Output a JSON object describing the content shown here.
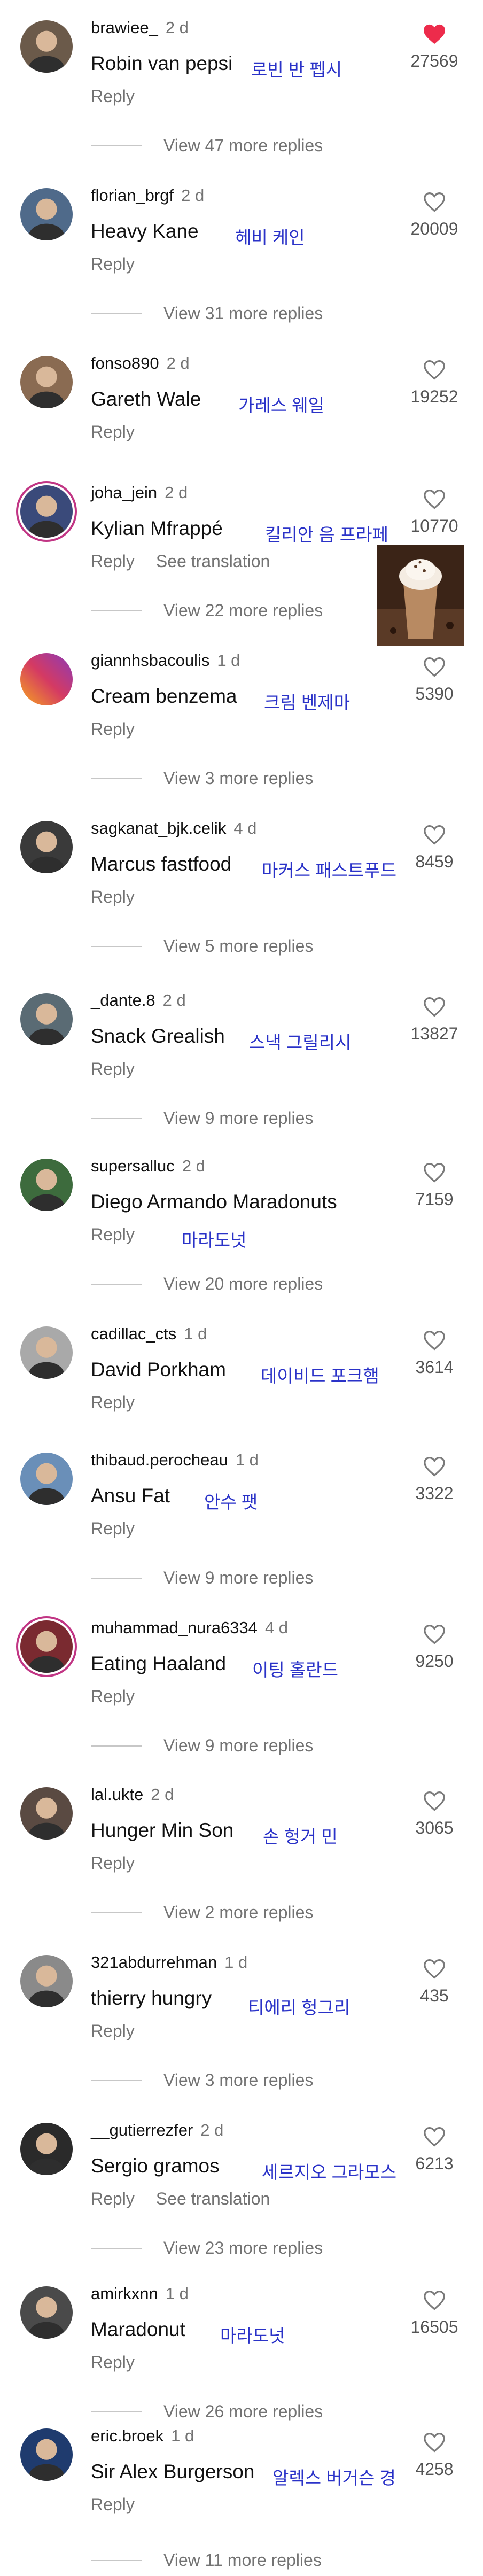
{
  "comments": [
    {
      "username": "brawiee_",
      "age": "2 d",
      "text": "Robin van pepsi",
      "korean": "로빈 반 펩시",
      "reply": "Reply",
      "likes": "27569",
      "liked": true,
      "view_more": "View 47 more replies",
      "avatar_color": "#6b5a4a"
    },
    {
      "username": "florian_brgf",
      "age": "2 d",
      "text": "Heavy Kane",
      "korean": "헤비 케인",
      "reply": "Reply",
      "likes": "20009",
      "liked": false,
      "view_more": "View 31 more replies",
      "avatar_color": "#4f6a8a"
    },
    {
      "username": "fonso890",
      "age": "2 d",
      "text": "Gareth Wale",
      "korean": "가레스 웨일",
      "reply": "Reply",
      "likes": "19252",
      "liked": false,
      "view_more": "View 22 more replies",
      "avatar_color": "#8a6b52"
    },
    {
      "username": "joha_jein",
      "age": "2 d",
      "text": "Kylian Mfrappé",
      "korean": "킬리안 음 프라페",
      "reply": "Reply",
      "translation": "See translation",
      "likes": "10770",
      "liked": false,
      "view_more": "View 22 more replies",
      "avatar_color": "#3a4a7a",
      "has_image": true
    },
    {
      "username": "giannhsbacoulis",
      "age": "1 d",
      "text": "Cream benzema",
      "korean": "크림 벤제마",
      "reply": "Reply",
      "likes": "5390",
      "liked": false,
      "view_more": "View 3 more replies",
      "avatar_color": "#d43a63"
    },
    {
      "username": "sagkanat_bjk.celik",
      "age": "4 d",
      "text": "Marcus fastfood",
      "korean": "마커스 패스트푸드",
      "reply": "Reply",
      "likes": "8459",
      "liked": false,
      "view_more": "View 5 more replies",
      "avatar_color": "#3a3a3a"
    },
    {
      "username": "_dante.8",
      "age": "2 d",
      "text": "Snack Grealish",
      "korean": "스낵 그릴리시",
      "reply": "Reply",
      "likes": "13827",
      "liked": false,
      "view_more": "View 9 more replies",
      "avatar_color": "#5a6b74"
    },
    {
      "username": "supersalluc",
      "age": "2 d",
      "text": "Diego Armando Maradonuts",
      "korean": "마라도넛",
      "reply": "Reply",
      "likes": "7159",
      "liked": false,
      "view_more": "View 20 more replies",
      "avatar_color": "#3d6b3d"
    },
    {
      "username": "cadillac_cts",
      "age": "1 d",
      "text": "David Porkham",
      "korean": "데이비드 포크햄",
      "reply": "Reply",
      "likes": "3614",
      "liked": false,
      "view_more": "",
      "avatar_color": "#a9a9a9"
    },
    {
      "username": "thibaud.perocheau",
      "age": "1 d",
      "text": "Ansu Fat",
      "korean": "안수 팻",
      "reply": "Reply",
      "likes": "3322",
      "liked": false,
      "view_more": "View 9 more replies",
      "avatar_color": "#6a8fb8"
    },
    {
      "username": "muhammad_nura6334",
      "age": "4 d",
      "text": "Eating Haaland",
      "korean": "이팅 홀란드",
      "reply": "Reply",
      "likes": "9250",
      "liked": false,
      "view_more": "View 9 more replies",
      "avatar_color": "#7a2a30",
      "ring": true
    },
    {
      "username": "lal.ukte",
      "age": "2 d",
      "text": "Hunger Min Son",
      "korean": "손 헝거 민",
      "reply": "Reply",
      "likes": "3065",
      "liked": false,
      "view_more": "View 2 more replies",
      "avatar_color": "#5a4a42"
    },
    {
      "username": "321abdurrehman",
      "age": "1 d",
      "text": "thierry hungry",
      "korean": "티에리 헝그리",
      "reply": "Reply",
      "likes": "435",
      "liked": false,
      "view_more": "View 3 more replies",
      "avatar_color": "#8a8a8a"
    },
    {
      "username": "__gutierrezfer",
      "age": "2 d",
      "text": "Sergio gramos",
      "korean": "세르지오 그라모스",
      "reply": "Reply",
      "translation": "See translation",
      "likes": "6213",
      "liked": false,
      "view_more": "View 23 more replies",
      "avatar_color": "#2a2a2a"
    },
    {
      "username": "amirkxnn",
      "age": "1 d",
      "text": "Maradonut",
      "korean": "마라도넛",
      "reply": "Reply",
      "likes": "16505",
      "liked": false,
      "view_more": "View 26 more replies",
      "avatar_color": "#4a4a4a"
    },
    {
      "username": "eric.broek",
      "age": "1 d",
      "text": "Sir Alex Burgerson",
      "korean": "알렉스 버거슨 경",
      "reply": "Reply",
      "likes": "4258",
      "liked": false,
      "view_more": "View 11 more replies",
      "avatar_color": "#1f3b6e"
    }
  ]
}
